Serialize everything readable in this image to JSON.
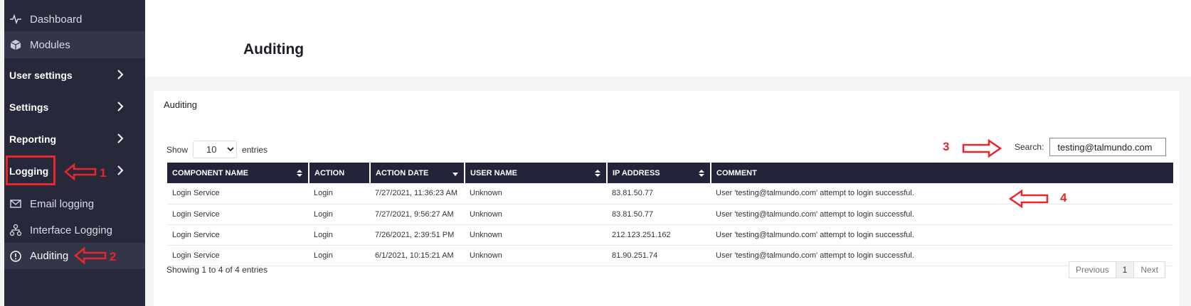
{
  "sidebar": {
    "items": [
      {
        "label": "Dashboard",
        "icon": "pulse-icon"
      },
      {
        "label": "Modules",
        "icon": "cube-icon"
      },
      {
        "label": "User settings"
      },
      {
        "label": "Settings"
      },
      {
        "label": "Reporting"
      },
      {
        "label": "Logging"
      },
      {
        "label": "Email logging",
        "icon": "envelope-icon"
      },
      {
        "label": "Interface Logging",
        "icon": "network-icon"
      },
      {
        "label": "Auditing",
        "icon": "alert-circle-icon"
      }
    ]
  },
  "header": {
    "title": "Auditing"
  },
  "card": {
    "title": "Auditing",
    "show_label": "Show",
    "entries_label": "entries",
    "page_size": "10",
    "search_label": "Search:",
    "search_value": "testing@talmundo.com",
    "columns": [
      "COMPONENT NAME",
      "ACTION",
      "ACTION DATE",
      "USER NAME",
      "IP ADDRESS",
      "COMMENT"
    ],
    "rows": [
      [
        "Login Service",
        "Login",
        "7/27/2021, 11:36:23 AM",
        "Unknown",
        "83.81.50.77",
        "User 'testing@talmundo.com' attempt to login successful."
      ],
      [
        "Login Service",
        "Login",
        "7/27/2021, 9:56:27 AM",
        "Unknown",
        "83.81.50.77",
        "User 'testing@talmundo.com' attempt to login successful."
      ],
      [
        "Login Service",
        "Login",
        "7/26/2021, 2:39:51 PM",
        "Unknown",
        "212.123.251.162",
        "User 'testing@talmundo.com' attempt to login successful."
      ],
      [
        "Login Service",
        "Login",
        "6/1/2021, 10:15:21 AM",
        "Unknown",
        "81.90.251.74",
        "User 'testing@talmundo.com' attempt to login successful."
      ]
    ],
    "info": "Showing 1 to 4 of 4 entries",
    "pager": {
      "previous": "Previous",
      "current": "1",
      "next": "Next"
    }
  },
  "annotations": [
    "1",
    "2",
    "3",
    "4"
  ],
  "colors": {
    "sidebar": "#272839",
    "table_header": "#22243a",
    "annotation": "#e8262b"
  }
}
